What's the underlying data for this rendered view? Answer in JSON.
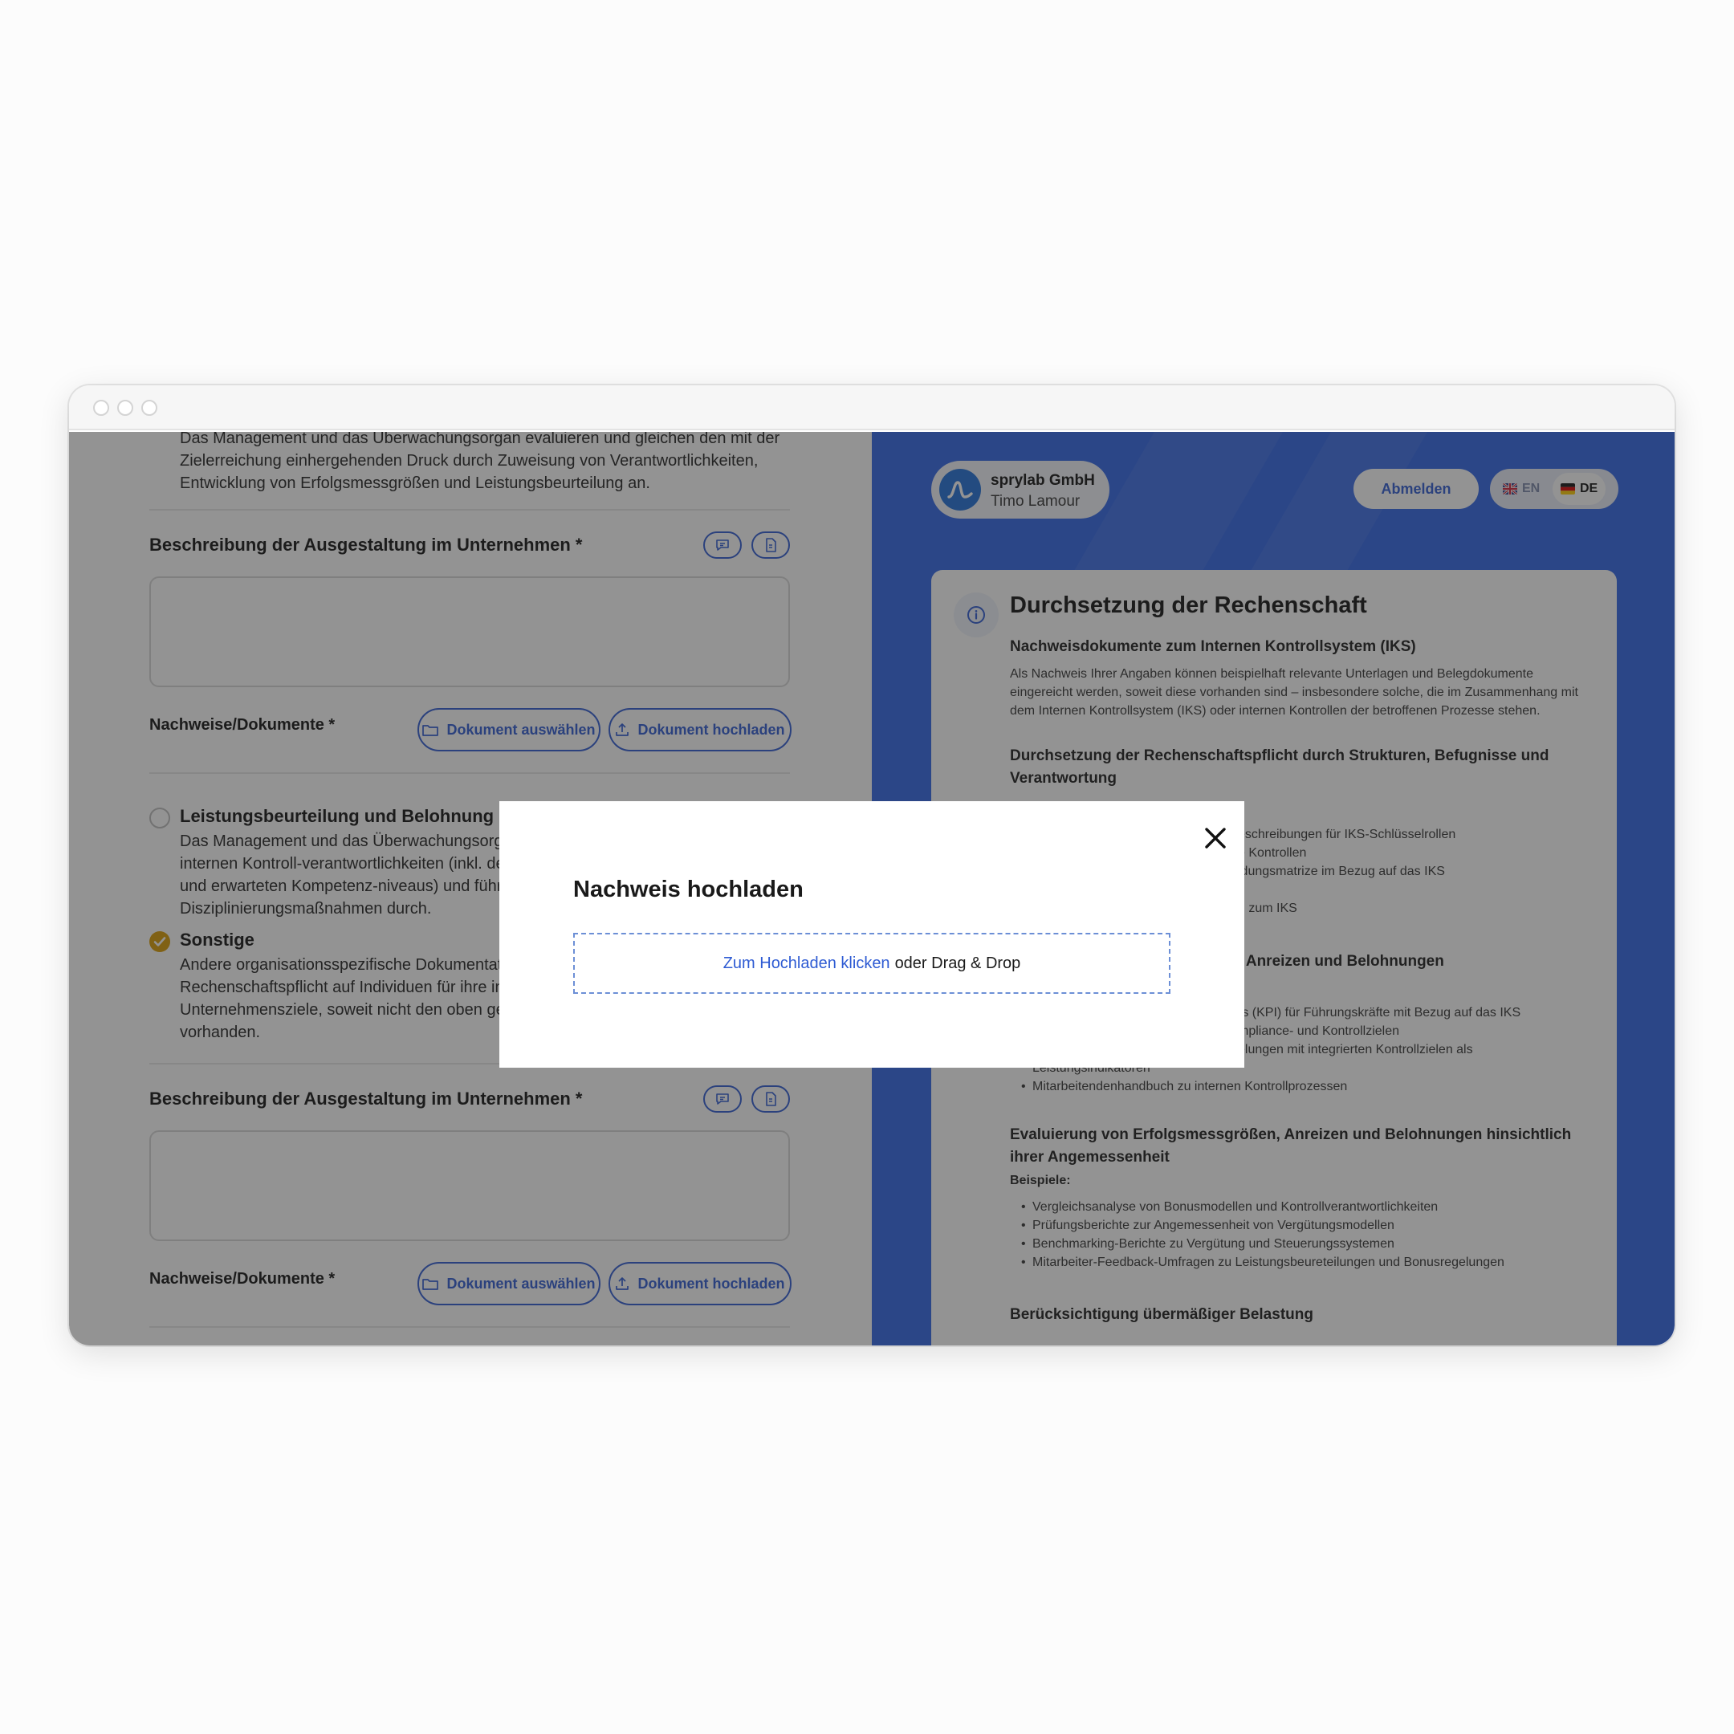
{
  "left": {
    "intro_paragraph": "Das Management und das Überwachungsorgan evaluieren und gleichen den mit der Zielerreichung einhergehenden Druck durch Zuweisung von Verantwortlichkeiten, Entwicklung von Erfolgsmessgrößen und Leistungsbeurteilung an.",
    "description_label": "Beschreibung der Ausgestaltung im Unternehmen *",
    "documents_label": "Nachweise/Dokumente *",
    "select_document_label": "Dokument auswählen",
    "upload_document_label": "Dokument hochladen",
    "options": [
      {
        "title": "Leistungsbeurteilung und Belohnung od",
        "checked": false,
        "lines": [
          "Das Management und das Überwachungsorga",
          "internen Kontroll-verantwortlichkeiten (inkl. de",
          "und erwarteten Kompetenz-niveaus) und führe",
          "Disziplinierungsmaßnahmen durch."
        ]
      },
      {
        "title": "Sonstige",
        "checked": true,
        "lines": [
          "Andere organisationsspezifische Dokumentat",
          "Rechenschaftspflicht auf Individuen für ihre in",
          "Unternehmensziele, soweit nicht den oben ge",
          "vorhanden."
        ]
      }
    ]
  },
  "header": {
    "company_name": "sprylab GmbH",
    "user_name": "Timo Lamour",
    "logout_label": "Abmelden",
    "lang_en": "EN",
    "lang_de": "DE",
    "active_lang": "DE"
  },
  "card": {
    "title": "Durchsetzung der Rechenschaft",
    "section1_title": "Nachweisdokumente zum Internen Kontrollsystem (IKS)",
    "section1_text": "Als Nachweis Ihrer Angaben können beispielhaft relevante Unterlagen und Belegdokumente eingereicht werden, soweit diese vorhanden sind – insbesondere solche, die im Zusammenhang mit dem Internen Kontrollsystem (IKS) oder internen Kontrollen der betroffenen Prozesse stehen.",
    "section2_title": "Durchsetzung der Rechenschaftspflicht durch Strukturen, Befugnisse und Verantwortung",
    "section2_bullets": [
      "eschreibungen für IKS-Schlüsselrollen",
      "e Kontrollen",
      "idungsmatrize im Bezug auf das IKS",
      "n zum IKS"
    ],
    "section3_title": ", Anreizen und Belohnungen",
    "section3_bullets": [
      "rs (KPI) für Führungskräfte mit Bezug auf das IKS",
      "mpliance- und Kontrollzielen",
      "elungen mit integrierten Kontrollzielen als",
      "Leistungsindikatoren",
      "Mitarbeitendenhandbuch zu internen Kontrollprozessen"
    ],
    "section4_title": "Evaluierung von Erfolgsmessgrößen, Anreizen und Belohnungen hinsichtlich ihrer Angemessenheit",
    "examples_label": "Beispiele:",
    "section4_bullets": [
      "Vergleichsanalyse von Bonusmodellen und Kontrollverantwortlichkeiten",
      "Prüfungsberichte zur Angemessenheit von Vergütungsmodellen",
      "Benchmarking-Berichte zu Vergütung und Steuerungssystemen",
      "Mitarbeiter-Feedback-Umfragen zu Leistungsbeureteilungen und Bonusregelungen"
    ],
    "section5_title": "Berücksichtigung übermäßiger Belastung"
  },
  "modal": {
    "title": "Nachweis hochladen",
    "upload_link": "Zum Hochladen klicken",
    "upload_hint": "oder Drag & Drop"
  },
  "colors": {
    "accent": "#2e5bd3",
    "panel_blue": "#2f64e6",
    "check_gold": "#d99a00"
  }
}
